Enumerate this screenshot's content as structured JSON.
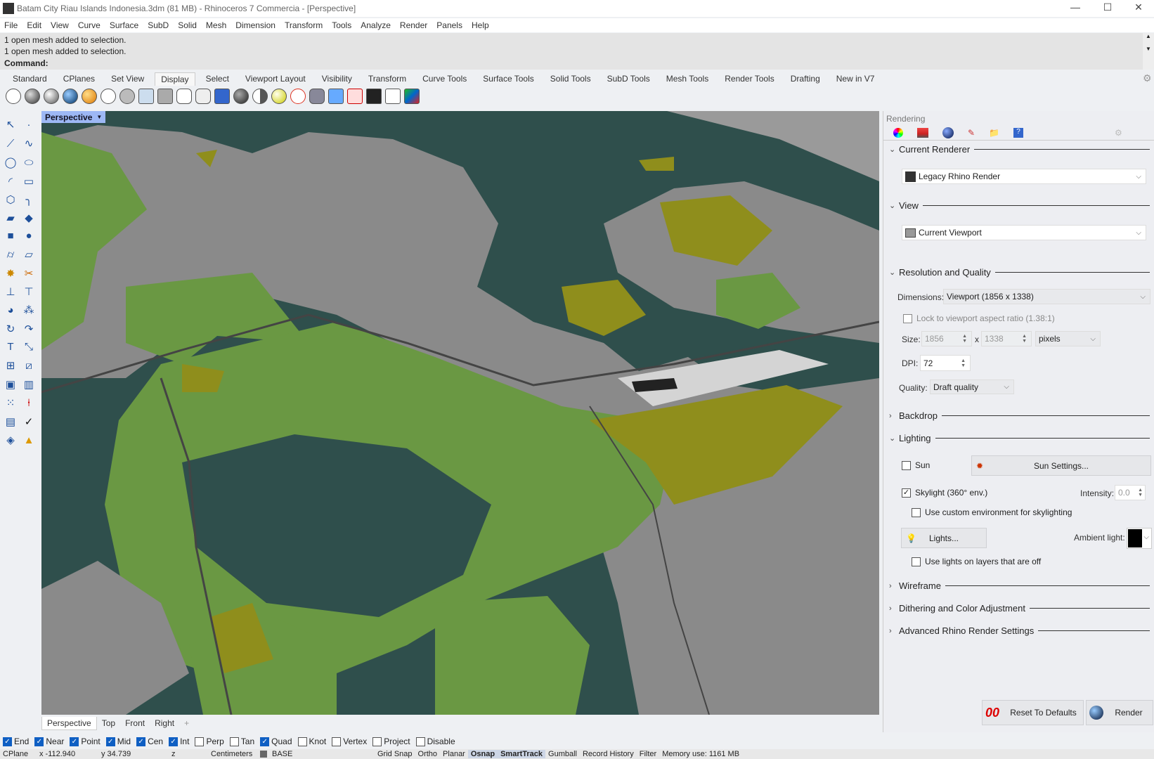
{
  "title": "Batam City Riau Islands Indonesia.3dm (81 MB) - Rhinoceros 7 Commercia - [Perspective]",
  "window_controls": {
    "minimize": "—",
    "maximize": "☐",
    "close": "✕"
  },
  "menu": [
    "File",
    "Edit",
    "View",
    "Curve",
    "Surface",
    "SubD",
    "Solid",
    "Mesh",
    "Dimension",
    "Transform",
    "Tools",
    "Analyze",
    "Render",
    "Panels",
    "Help"
  ],
  "command_history": [
    "1 open mesh added to selection.",
    "1 open mesh added to selection."
  ],
  "command_prompt": "Command:",
  "toolbar_tabs": [
    "Standard",
    "CPlanes",
    "Set View",
    "Display",
    "Select",
    "Viewport Layout",
    "Visibility",
    "Transform",
    "Curve Tools",
    "Surface Tools",
    "Solid Tools",
    "SubD Tools",
    "Mesh Tools",
    "Render Tools",
    "Drafting",
    "New in V7"
  ],
  "active_toolbar_tab": "Display",
  "viewport": {
    "label": "Perspective",
    "colors": {
      "water": "#2f4f4c",
      "land": "#8b8b8b",
      "green": "#6a9843",
      "olive": "#8f8e1c"
    }
  },
  "viewport_tabs": [
    "Perspective",
    "Top",
    "Front",
    "Right",
    "+"
  ],
  "osnaps": [
    {
      "label": "End",
      "on": true
    },
    {
      "label": "Near",
      "on": true
    },
    {
      "label": "Point",
      "on": true
    },
    {
      "label": "Mid",
      "on": true
    },
    {
      "label": "Cen",
      "on": true
    },
    {
      "label": "Int",
      "on": true
    },
    {
      "label": "Perp",
      "on": false
    },
    {
      "label": "Tan",
      "on": false
    },
    {
      "label": "Quad",
      "on": true
    },
    {
      "label": "Knot",
      "on": false
    },
    {
      "label": "Vertex",
      "on": false
    },
    {
      "label": "Project",
      "on": false
    },
    {
      "label": "Disable",
      "on": false
    }
  ],
  "status": {
    "cplane": "CPlane",
    "x": "x -112.940",
    "y": "y 34.739",
    "z": "z",
    "units": "Centimeters",
    "layer": "BASE",
    "grid_snap": "Grid Snap",
    "ortho": "Ortho",
    "planar": "Planar",
    "osnap": "Osnap",
    "smarttrack": "SmartTrack",
    "gumball": "Gumball",
    "record_history": "Record History",
    "filter": "Filter",
    "memory": "Memory use: 1161 MB"
  },
  "panel": {
    "title": "Rendering",
    "current_renderer": {
      "heading": "Current Renderer",
      "value": "Legacy Rhino Render"
    },
    "view": {
      "heading": "View",
      "value": "Current Viewport"
    },
    "resolution": {
      "heading": "Resolution and Quality",
      "dimensions_label": "Dimensions:",
      "dimensions_value": "Viewport (1856 x 1338)",
      "lock_label": "Lock to viewport aspect ratio (1.38:1)",
      "size_label": "Size:",
      "width": "1856",
      "x": "x",
      "height": "1338",
      "units": "pixels",
      "dpi_label": "DPI:",
      "dpi": "72",
      "quality_label": "Quality:",
      "quality": "Draft quality"
    },
    "backdrop": "Backdrop",
    "lighting": {
      "heading": "Lighting",
      "sun": "Sun",
      "sun_settings": "Sun Settings...",
      "skylight": "Skylight (360° env.)",
      "intensity_label": "Intensity:",
      "intensity": "0.0",
      "custom_env": "Use custom environment for skylighting",
      "lights": "Lights...",
      "ambient_label": "Ambient light:",
      "ambient_color": "#000000",
      "lights_off_layers": "Use lights on layers that are off"
    },
    "wireframe": "Wireframe",
    "dithering": "Dithering and Color Adjustment",
    "advanced": "Advanced Rhino Render Settings",
    "reset": "Reset To Defaults",
    "render": "Render"
  }
}
